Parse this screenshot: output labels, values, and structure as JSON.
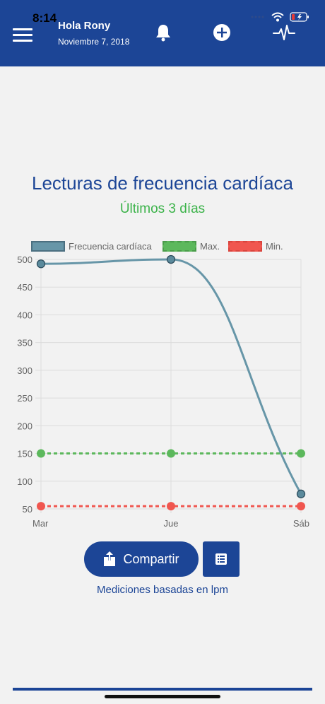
{
  "status_bar": {
    "time": "8:14"
  },
  "header": {
    "greeting": "Hola Rony",
    "date": "Noviembre 7, 2018",
    "icons": [
      "menu-icon",
      "bell-icon",
      "plus-circle-icon",
      "heartbeat-icon"
    ]
  },
  "colors": {
    "brand": "#1c4596",
    "series": "#6796a8",
    "max": "#5cb85c",
    "min": "#f0564f",
    "subtitle": "#3cb34a"
  },
  "chart": {
    "title": "Lecturas de frecuencia cardíaca",
    "subtitle": "Últimos 3 días",
    "legend": [
      "Frecuencia cardíaca",
      "Max.",
      "Min."
    ]
  },
  "chart_data": {
    "type": "line",
    "categories": [
      "Mar",
      "Jue",
      "Sáb"
    ],
    "series": [
      {
        "name": "Frecuencia cardíaca",
        "values": [
          492,
          500,
          77
        ]
      },
      {
        "name": "Max.",
        "values": [
          150,
          150,
          150
        ]
      },
      {
        "name": "Min.",
        "values": [
          55,
          55,
          55
        ]
      }
    ],
    "ylim": [
      50,
      500
    ],
    "yticks": [
      50,
      100,
      150,
      200,
      250,
      300,
      350,
      400,
      450,
      500
    ],
    "grid": true,
    "legend_position": "top"
  },
  "actions": {
    "share_label": "Compartir"
  },
  "footer_note": "Mediciones basadas en lpm"
}
